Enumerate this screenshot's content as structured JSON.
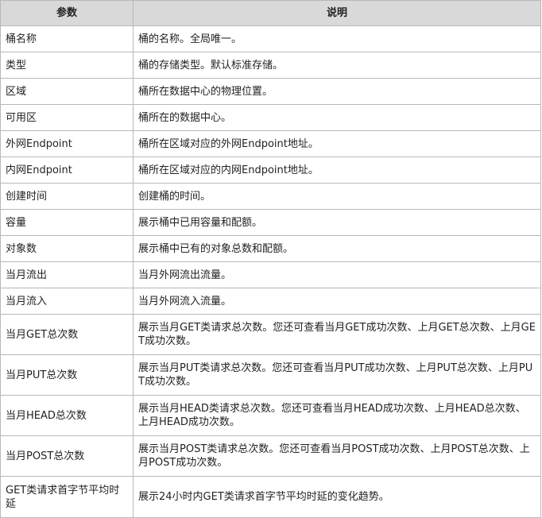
{
  "table": {
    "headers": [
      "参数",
      "说明"
    ],
    "rows": [
      {
        "param": "桶名称",
        "desc": "桶的名称。全局唯一。"
      },
      {
        "param": "类型",
        "desc": "桶的存储类型。默认标准存储。"
      },
      {
        "param": "区域",
        "desc": "桶所在数据中心的物理位置。"
      },
      {
        "param": "可用区",
        "desc": "桶所在的数据中心。"
      },
      {
        "param": "外网Endpoint",
        "desc": "桶所在区域对应的外网Endpoint地址。"
      },
      {
        "param": "内网Endpoint",
        "desc": "桶所在区域对应的内网Endpoint地址。"
      },
      {
        "param": "创建时间",
        "desc": "创建桶的时间。"
      },
      {
        "param": "容量",
        "desc": "展示桶中已用容量和配额。"
      },
      {
        "param": "对象数",
        "desc": "展示桶中已有的对象总数和配额。"
      },
      {
        "param": "当月流出",
        "desc": "当月外网流出流量。"
      },
      {
        "param": "当月流入",
        "desc": "当月外网流入流量。"
      },
      {
        "param": "当月GET总次数",
        "desc": "展示当月GET类请求总次数。您还可查看当月GET成功次数、上月GET总次数、上月GET成功次数。"
      },
      {
        "param": "当月PUT总次数",
        "desc": "展示当月PUT类请求总次数。您还可查看当月PUT成功次数、上月PUT总次数、上月PUT成功次数。"
      },
      {
        "param": "当月HEAD总次数",
        "desc": "展示当月HEAD类请求总次数。您还可查看当月HEAD成功次数、上月HEAD总次数、上月HEAD成功次数。"
      },
      {
        "param": "当月POST总次数",
        "desc": "展示当月POST类请求总次数。您还可查看当月POST成功次数、上月POST总次数、上月POST成功次数。"
      },
      {
        "param": "GET类请求首字节平均时延",
        "desc": "展示24小时内GET类请求首字节平均时延的变化趋势。"
      }
    ]
  }
}
